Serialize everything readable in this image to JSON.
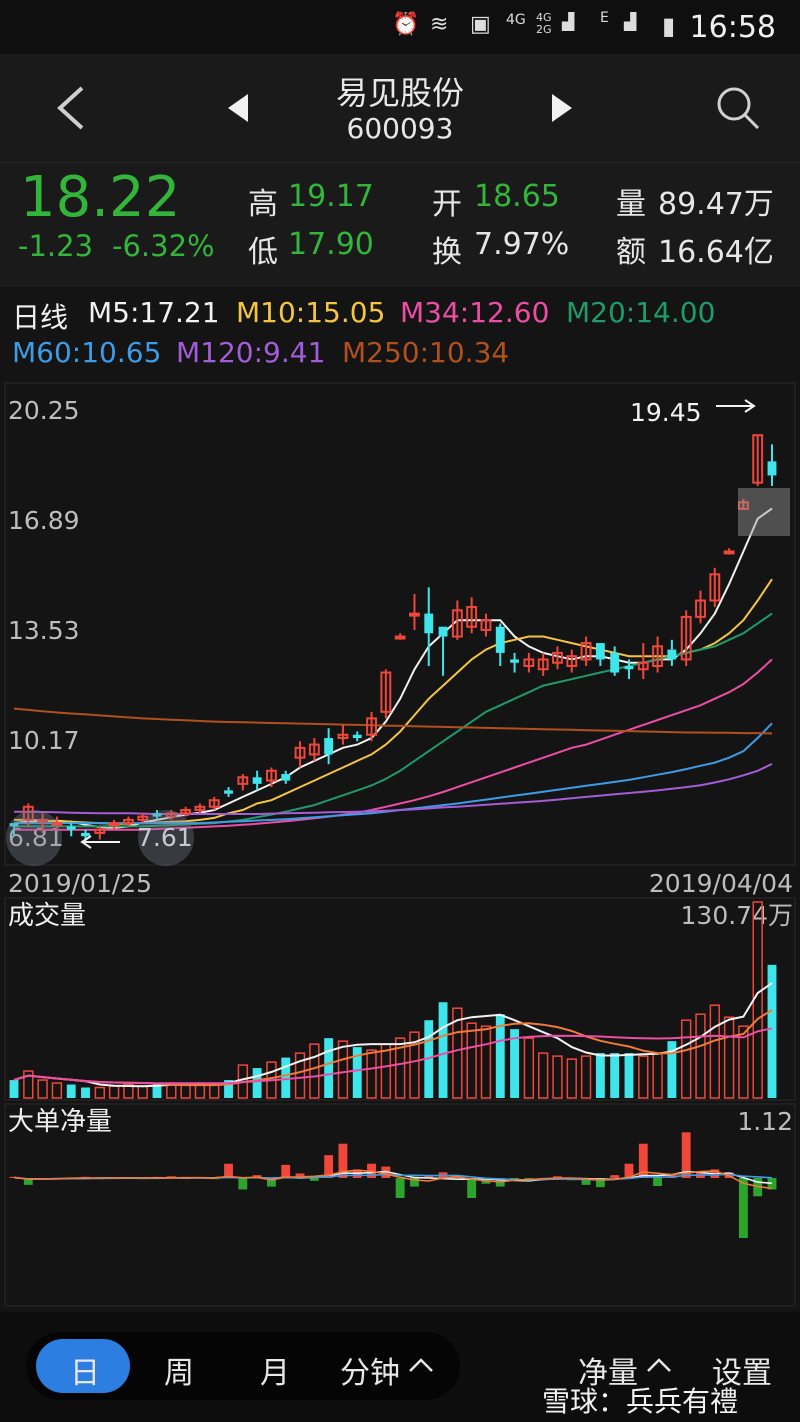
{
  "status_bar": {
    "time": "16:58",
    "net_4g": "4G",
    "net_4g2g": "4G 2G",
    "net_e": "E"
  },
  "nav": {
    "back": "<",
    "prev": "◀",
    "next": "▶",
    "stock_name": "易见股份",
    "stock_code": "600093",
    "search": "search-icon"
  },
  "quote": {
    "price": "18.22",
    "change": "-1.23",
    "change_pct": "-6.32%",
    "high_label": "高",
    "high": "19.17",
    "low_label": "低",
    "low": "17.90",
    "open_label": "开",
    "open": "18.65",
    "turnover_label": "换",
    "turnover": "7.97%",
    "volume_label": "量",
    "volume": "89.47万",
    "amount_label": "额",
    "amount": "16.64亿"
  },
  "ma_legend": {
    "period": "日线",
    "items": [
      {
        "label": "M5:17.21",
        "color": "#f2f2f2"
      },
      {
        "label": "M10:15.05",
        "color": "#f5c542"
      },
      {
        "label": "M34:12.60",
        "color": "#ec4ea4"
      },
      {
        "label": "M20:14.00",
        "color": "#1f9a6a"
      },
      {
        "label": "M60:10.65",
        "color": "#3e9be6"
      },
      {
        "label": "M120:9.41",
        "color": "#a35dd6"
      },
      {
        "label": "M250:10.34",
        "color": "#b0501e"
      }
    ]
  },
  "chart_data": [
    {
      "type": "candlestick",
      "title": "",
      "y_ticks": [
        "20.25",
        "16.89",
        "13.53",
        "10.17"
      ],
      "y_bottom_label": "6.81",
      "ylim": [
        6.81,
        20.25
      ],
      "x_start_label": "2019/01/25",
      "x_end_label": "2019/04/04",
      "annotations": {
        "max_label": "19.45",
        "min_label": "7.61"
      },
      "candles": [
        [
          7.6,
          7.5,
          7.2,
          7.5
        ],
        [
          7.7,
          8.1,
          7.5,
          8.2
        ],
        [
          7.7,
          7.7,
          7.3,
          7.9
        ],
        [
          7.6,
          7.6,
          7.4,
          7.8
        ],
        [
          7.5,
          7.4,
          7.2,
          7.6
        ],
        [
          7.3,
          7.2,
          7.0,
          7.4
        ],
        [
          7.3,
          7.4,
          7.1,
          7.5
        ],
        [
          7.6,
          7.6,
          7.4,
          7.7
        ],
        [
          7.6,
          7.7,
          7.5,
          7.8
        ],
        [
          7.7,
          7.8,
          7.6,
          7.9
        ],
        [
          7.9,
          7.8,
          7.7,
          8.0
        ],
        [
          7.8,
          7.9,
          7.7,
          8.0
        ],
        [
          7.9,
          8.0,
          7.8,
          8.1
        ],
        [
          8.0,
          8.1,
          7.9,
          8.2
        ],
        [
          8.1,
          8.3,
          8.0,
          8.4
        ],
        [
          8.6,
          8.5,
          8.4,
          8.7
        ],
        [
          8.8,
          9.0,
          8.6,
          9.1
        ],
        [
          9.0,
          8.8,
          8.6,
          9.2
        ],
        [
          8.9,
          9.2,
          8.7,
          9.3
        ],
        [
          9.1,
          8.9,
          8.8,
          9.2
        ],
        [
          9.6,
          9.9,
          9.3,
          10.1
        ],
        [
          9.7,
          10.0,
          9.5,
          10.2
        ],
        [
          10.2,
          9.7,
          9.4,
          10.5
        ],
        [
          10.2,
          10.3,
          10.0,
          10.6
        ],
        [
          10.3,
          10.2,
          10.1,
          10.4
        ],
        [
          10.3,
          10.8,
          10.1,
          11.0
        ],
        [
          11.0,
          12.2,
          10.8,
          12.3
        ],
        [
          13.3,
          13.3,
          13.2,
          13.4
        ],
        [
          14.0,
          14.0,
          13.5,
          14.6
        ],
        [
          14.0,
          13.4,
          12.4,
          14.8
        ],
        [
          13.6,
          13.3,
          12.1,
          13.5
        ],
        [
          13.3,
          14.1,
          13.2,
          14.4
        ],
        [
          13.6,
          14.2,
          13.4,
          14.5
        ],
        [
          13.5,
          13.8,
          13.3,
          14.0
        ],
        [
          13.6,
          12.8,
          12.4,
          13.7
        ],
        [
          12.6,
          12.5,
          12.2,
          12.8
        ],
        [
          12.4,
          12.6,
          12.2,
          12.8
        ],
        [
          12.3,
          12.6,
          12.1,
          12.8
        ],
        [
          12.5,
          12.8,
          12.3,
          13.0
        ],
        [
          12.4,
          12.7,
          12.2,
          12.9
        ],
        [
          12.6,
          13.1,
          12.4,
          13.3
        ],
        [
          13.1,
          12.6,
          12.4,
          13.1
        ],
        [
          12.8,
          12.2,
          12.1,
          13.0
        ],
        [
          12.4,
          12.3,
          12.0,
          12.6
        ],
        [
          12.3,
          12.5,
          12.0,
          13.1
        ],
        [
          12.4,
          13.0,
          12.2,
          13.3
        ],
        [
          12.9,
          12.6,
          12.4,
          13.2
        ],
        [
          12.6,
          13.9,
          12.4,
          14.1
        ],
        [
          13.9,
          14.4,
          13.7,
          14.7
        ],
        [
          14.4,
          15.2,
          14.2,
          15.4
        ],
        [
          15.9,
          15.9,
          15.8,
          16.0
        ],
        [
          17.2,
          17.4,
          17.2,
          17.5
        ],
        [
          18.0,
          19.45,
          17.9,
          19.45
        ],
        [
          18.65,
          18.22,
          17.9,
          19.17
        ]
      ],
      "ma_series": [
        {
          "name": "M5",
          "values": [
            7.6,
            7.65,
            7.66,
            7.67,
            7.64,
            7.55,
            7.48,
            7.46,
            7.5,
            7.62,
            7.7,
            7.78,
            7.86,
            7.92,
            8.0,
            8.2,
            8.4,
            8.6,
            8.8,
            9.0,
            9.3,
            9.5,
            9.7,
            9.9,
            10.0,
            10.2,
            10.7,
            11.4,
            12.3,
            13.0,
            13.4,
            13.8,
            13.8,
            13.8,
            13.8,
            13.3,
            13.0,
            12.8,
            12.7,
            12.6,
            12.7,
            12.7,
            12.6,
            12.5,
            12.5,
            12.6,
            12.6,
            12.9,
            13.4,
            14.0,
            14.9,
            15.9,
            16.9,
            17.21
          ]
        },
        {
          "name": "M10",
          "values": [
            7.7,
            7.7,
            7.68,
            7.66,
            7.64,
            7.62,
            7.6,
            7.58,
            7.58,
            7.6,
            7.62,
            7.64,
            7.66,
            7.7,
            7.76,
            7.9,
            8.0,
            8.2,
            8.3,
            8.5,
            8.7,
            8.9,
            9.1,
            9.3,
            9.5,
            9.7,
            10.0,
            10.4,
            10.9,
            11.4,
            11.8,
            12.2,
            12.6,
            12.9,
            13.1,
            13.2,
            13.3,
            13.3,
            13.2,
            13.1,
            13.0,
            12.9,
            12.8,
            12.7,
            12.7,
            12.7,
            12.7,
            12.8,
            12.9,
            13.1,
            13.4,
            13.8,
            14.4,
            15.05
          ]
        },
        {
          "name": "M20",
          "values": [
            7.5,
            7.5,
            7.5,
            7.5,
            7.5,
            7.5,
            7.5,
            7.5,
            7.5,
            7.5,
            7.52,
            7.54,
            7.56,
            7.58,
            7.6,
            7.65,
            7.7,
            7.78,
            7.86,
            7.95,
            8.05,
            8.15,
            8.3,
            8.45,
            8.6,
            8.75,
            8.95,
            9.2,
            9.5,
            9.8,
            10.1,
            10.4,
            10.7,
            11.0,
            11.2,
            11.4,
            11.6,
            11.8,
            11.9,
            12.0,
            12.1,
            12.2,
            12.3,
            12.4,
            12.5,
            12.6,
            12.7,
            12.8,
            12.9,
            13.0,
            13.2,
            13.4,
            13.7,
            14.0
          ]
        },
        {
          "name": "M34",
          "values": [
            7.4,
            7.4,
            7.4,
            7.4,
            7.4,
            7.4,
            7.4,
            7.4,
            7.4,
            7.4,
            7.42,
            7.44,
            7.46,
            7.48,
            7.5,
            7.52,
            7.55,
            7.58,
            7.62,
            7.66,
            7.7,
            7.75,
            7.8,
            7.86,
            7.92,
            8.0,
            8.1,
            8.2,
            8.3,
            8.42,
            8.55,
            8.7,
            8.85,
            9.0,
            9.15,
            9.3,
            9.45,
            9.6,
            9.75,
            9.9,
            10.0,
            10.15,
            10.3,
            10.45,
            10.6,
            10.75,
            10.9,
            11.05,
            11.2,
            11.4,
            11.6,
            11.85,
            12.2,
            12.6
          ]
        },
        {
          "name": "M60",
          "values": [
            7.6,
            7.6,
            7.6,
            7.6,
            7.6,
            7.6,
            7.6,
            7.6,
            7.6,
            7.6,
            7.6,
            7.6,
            7.6,
            7.6,
            7.62,
            7.64,
            7.66,
            7.68,
            7.7,
            7.72,
            7.75,
            7.78,
            7.81,
            7.84,
            7.87,
            7.9,
            7.95,
            8.0,
            8.05,
            8.1,
            8.15,
            8.2,
            8.26,
            8.32,
            8.38,
            8.44,
            8.5,
            8.56,
            8.62,
            8.68,
            8.74,
            8.8,
            8.86,
            8.92,
            9.0,
            9.08,
            9.16,
            9.25,
            9.35,
            9.45,
            9.6,
            9.8,
            10.2,
            10.65
          ]
        },
        {
          "name": "M120",
          "values": [
            7.95,
            7.95,
            7.94,
            7.93,
            7.92,
            7.91,
            7.9,
            7.9,
            7.9,
            7.89,
            7.88,
            7.88,
            7.88,
            7.88,
            7.88,
            7.88,
            7.88,
            7.88,
            7.89,
            7.9,
            7.91,
            7.92,
            7.93,
            7.94,
            7.95,
            7.96,
            7.98,
            8.0,
            8.02,
            8.05,
            8.08,
            8.1,
            8.13,
            8.16,
            8.19,
            8.22,
            8.25,
            8.28,
            8.32,
            8.36,
            8.4,
            8.44,
            8.48,
            8.52,
            8.56,
            8.6,
            8.65,
            8.7,
            8.76,
            8.84,
            8.94,
            9.06,
            9.2,
            9.41
          ]
        },
        {
          "name": "M250",
          "values": [
            11.1,
            11.06,
            11.02,
            10.98,
            10.95,
            10.92,
            10.89,
            10.86,
            10.83,
            10.8,
            10.78,
            10.76,
            10.74,
            10.72,
            10.7,
            10.69,
            10.68,
            10.67,
            10.66,
            10.65,
            10.64,
            10.63,
            10.62,
            10.61,
            10.6,
            10.59,
            10.58,
            10.57,
            10.56,
            10.55,
            10.54,
            10.53,
            10.52,
            10.51,
            10.5,
            10.49,
            10.48,
            10.47,
            10.46,
            10.45,
            10.44,
            10.43,
            10.42,
            10.41,
            10.4,
            10.39,
            10.38,
            10.37,
            10.37,
            10.36,
            10.36,
            10.35,
            10.35,
            10.34
          ]
        }
      ]
    },
    {
      "type": "bar",
      "title": "成交量",
      "max_label": "130.74万",
      "values": [
        12,
        18,
        12,
        10,
        9,
        7,
        7,
        8,
        9,
        8,
        9,
        10,
        9,
        10,
        9,
        12,
        22,
        20,
        24,
        27,
        30,
        36,
        40,
        38,
        34,
        32,
        36,
        40,
        44,
        52,
        64,
        60,
        50,
        48,
        56,
        46,
        40,
        30,
        28,
        26,
        28,
        30,
        30,
        30,
        28,
        30,
        38,
        52,
        56,
        62,
        54,
        48,
        131,
        89
      ]
    },
    {
      "type": "bar",
      "title": "大单净量",
      "max_label": "1.12",
      "values": [
        0.02,
        -0.12,
        -0.03,
        0.0,
        0.0,
        0.02,
        -0.02,
        0.01,
        0.01,
        -0.02,
        0.02,
        0.03,
        0.0,
        0.01,
        -0.02,
        0.25,
        -0.2,
        0.05,
        -0.15,
        0.23,
        0.08,
        -0.05,
        0.4,
        0.6,
        0.15,
        0.25,
        0.2,
        -0.35,
        -0.15,
        0.05,
        0.1,
        0.05,
        -0.35,
        -0.1,
        -0.15,
        -0.05,
        -0.05,
        0.0,
        0.03,
        -0.04,
        -0.12,
        -0.16,
        0.05,
        0.25,
        0.6,
        -0.14,
        0.06,
        0.8,
        0.1,
        0.15,
        0.1,
        -1.05,
        -0.32,
        -0.2
      ]
    }
  ],
  "bottom_bar": {
    "tabs": [
      "日",
      "周",
      "月",
      "分钟"
    ],
    "active": "日",
    "net_volume": "净量",
    "settings": "设置",
    "watermark": "雪球：兵兵有禮"
  }
}
